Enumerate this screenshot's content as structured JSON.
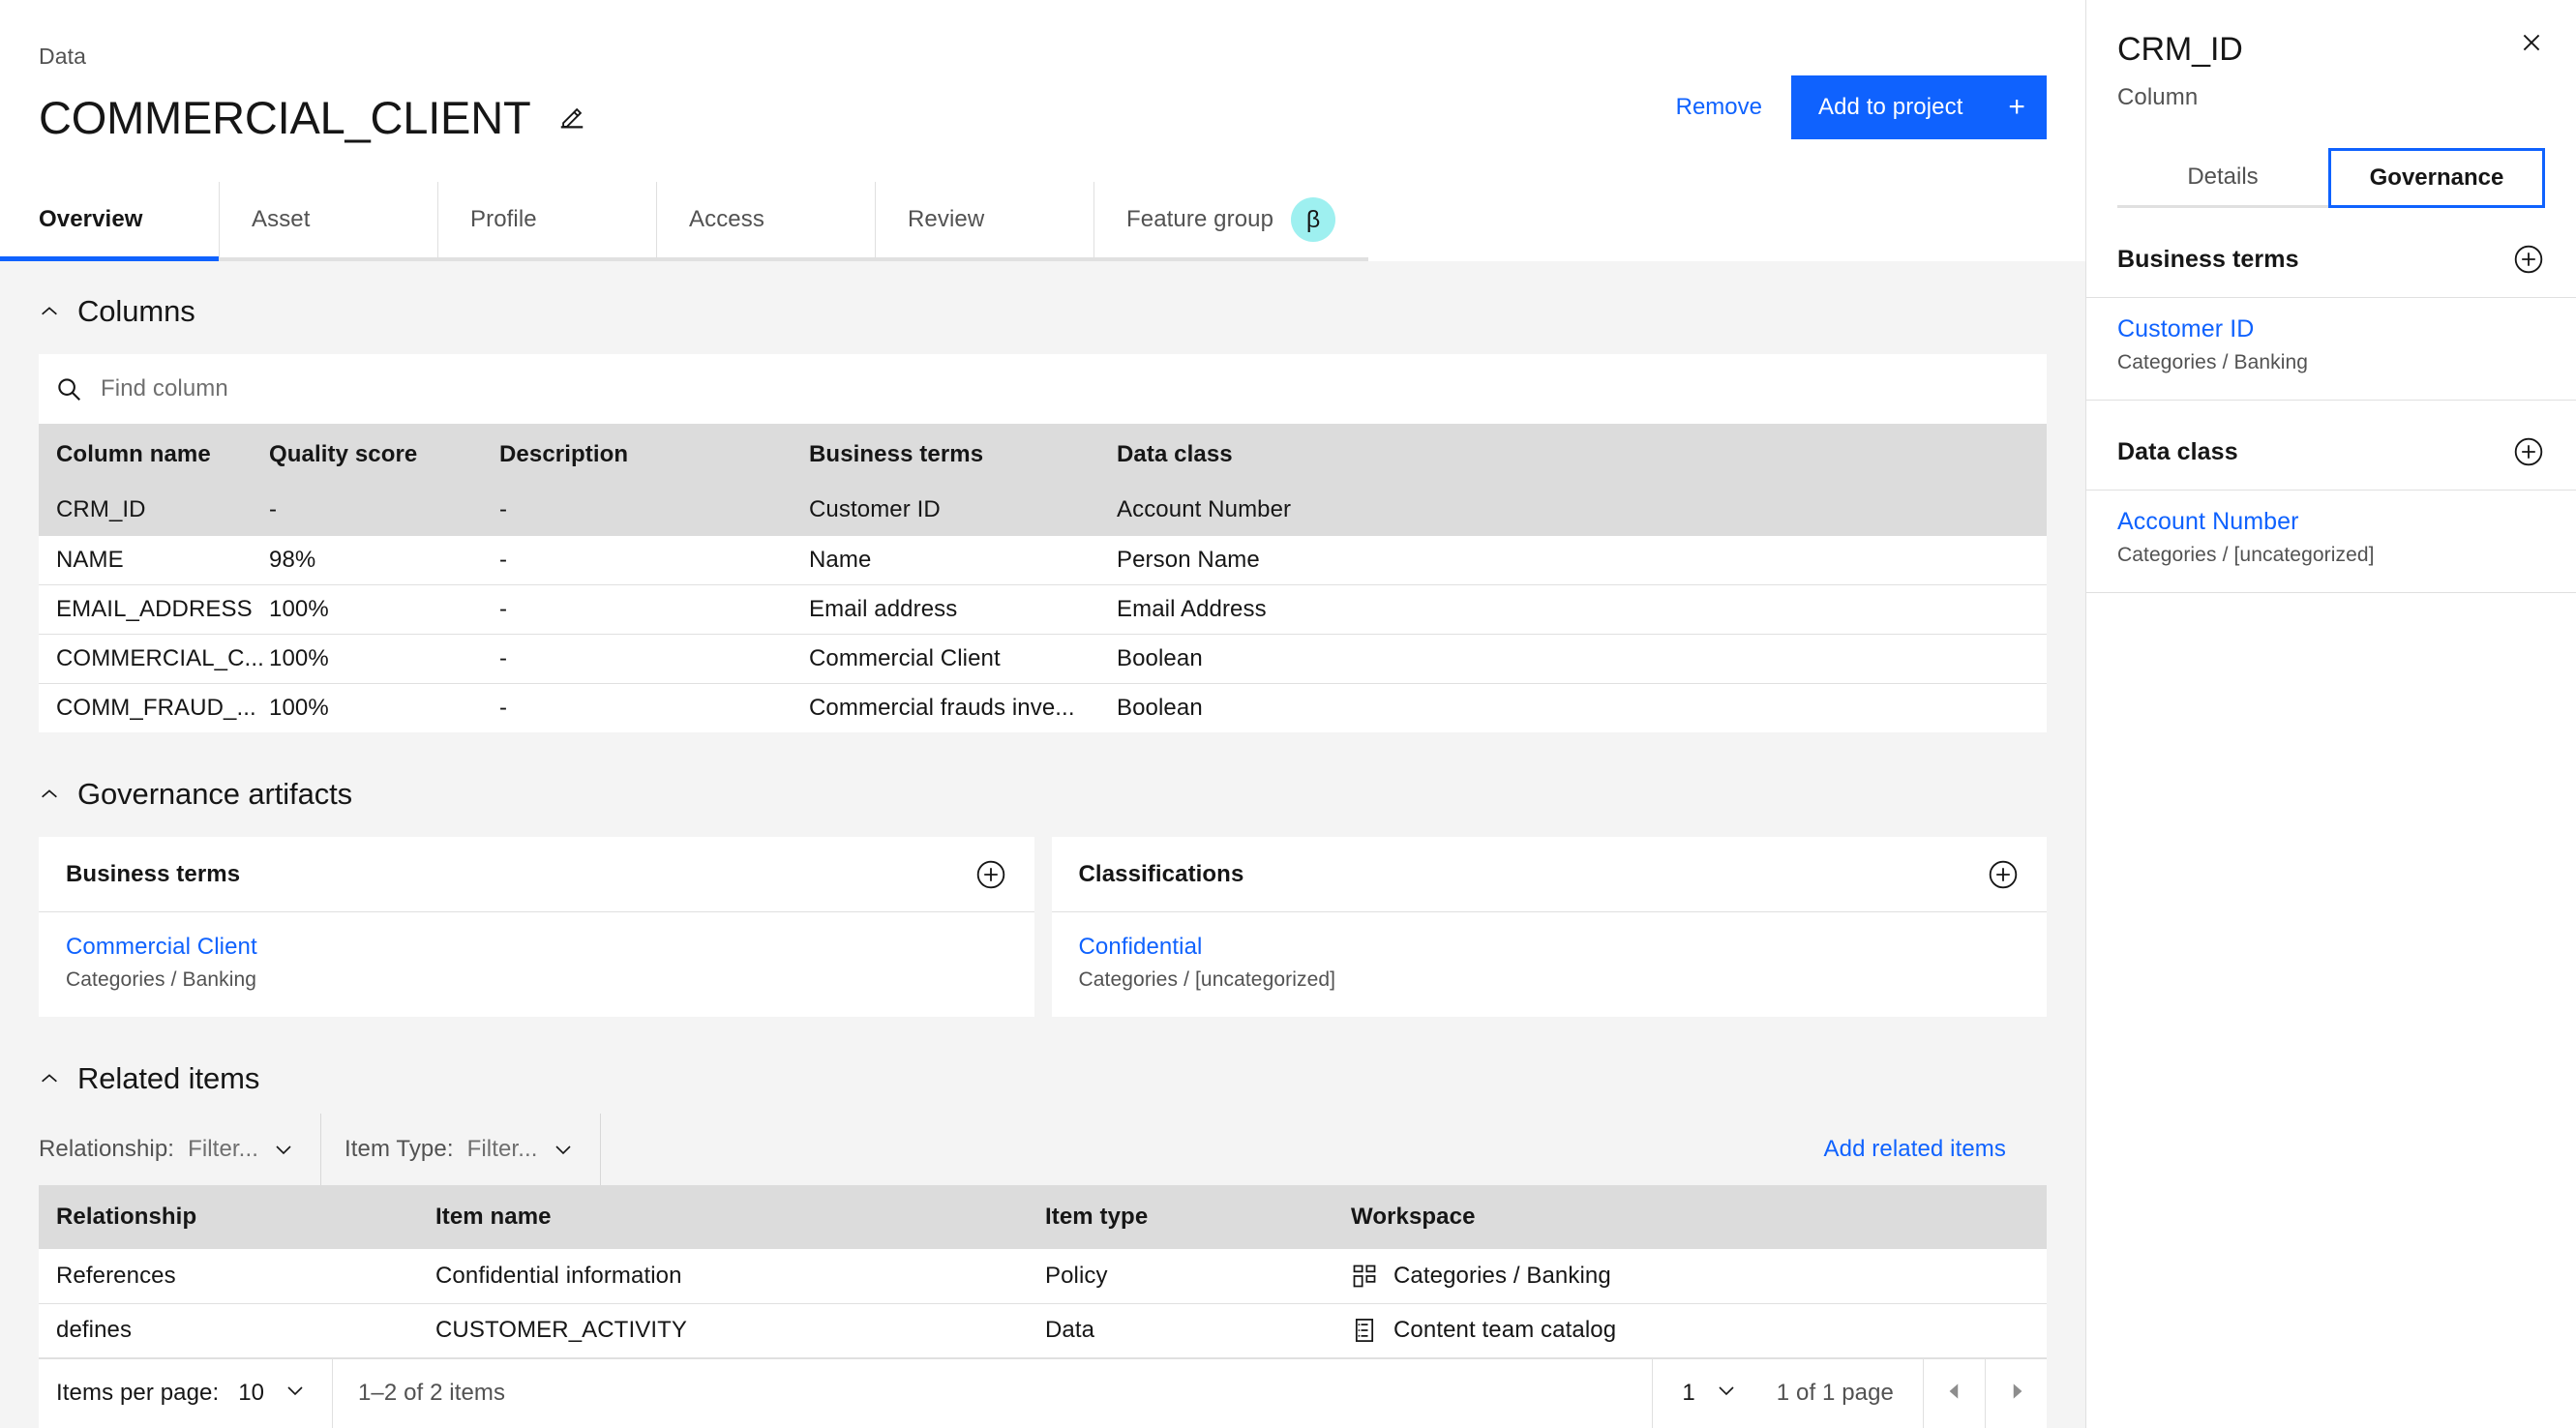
{
  "header": {
    "breadcrumb": "Data",
    "title": "COMMERCIAL_CLIENT",
    "edit_icon": "pencil-edit-icon",
    "remove_label": "Remove",
    "add_to_project_label": "Add to project",
    "add_to_project_plus": "+"
  },
  "tabs": [
    {
      "label": "Overview",
      "active": true
    },
    {
      "label": "Asset",
      "active": false
    },
    {
      "label": "Profile",
      "active": false
    },
    {
      "label": "Access",
      "active": false
    },
    {
      "label": "Review",
      "active": false
    },
    {
      "label": "Feature group",
      "active": false,
      "badge": "β"
    }
  ],
  "columns_section": {
    "title": "Columns",
    "collapse_icon": "chevron-up-icon",
    "search": {
      "placeholder": "Find column",
      "value": "",
      "icon": "search-icon"
    },
    "table": {
      "headers": [
        "Column name",
        "Quality score",
        "Description",
        "Business terms",
        "Data class"
      ],
      "rows": [
        {
          "selected": true,
          "cells": [
            "CRM_ID",
            "-",
            "-",
            "Customer ID",
            "Account Number"
          ]
        },
        {
          "selected": false,
          "cells": [
            "NAME",
            "98%",
            "-",
            "Name",
            "Person Name"
          ]
        },
        {
          "selected": false,
          "cells": [
            "EMAIL_ADDRESS",
            "100%",
            "-",
            "Email address",
            "Email Address"
          ]
        },
        {
          "selected": false,
          "cells": [
            "COMMERCIAL_C...",
            "100%",
            "-",
            "Commercial Client",
            "Boolean"
          ]
        },
        {
          "selected": false,
          "cells": [
            "COMM_FRAUD_...",
            "100%",
            "-",
            "Commercial frauds inve...",
            "Boolean"
          ]
        }
      ]
    }
  },
  "governance_section": {
    "title": "Governance artifacts",
    "collapse_icon": "chevron-up-icon",
    "cards": [
      {
        "heading": "Business terms",
        "add_icon": "add-circle-icon",
        "link": "Commercial Client",
        "category_label": "Categories",
        "separator": "/",
        "category_value": "Banking"
      },
      {
        "heading": "Classifications",
        "add_icon": "add-circle-icon",
        "link": "Confidential",
        "category_label": "Categories",
        "separator": "/",
        "category_value": "[uncategorized]"
      }
    ]
  },
  "related_section": {
    "title": "Related items",
    "collapse_icon": "chevron-up-icon",
    "filters": [
      {
        "label": "Relationship:",
        "value": "Filter...",
        "icon": "chevron-down-icon"
      },
      {
        "label": "Item Type:",
        "value": "Filter...",
        "icon": "chevron-down-icon"
      }
    ],
    "add_related_label": "Add related items",
    "add_related_icon": "chevron-down-icon",
    "table": {
      "headers": [
        "Relationship",
        "Item name",
        "Item type",
        "Workspace"
      ],
      "rows": [
        {
          "relationship": "References",
          "item_name": "Confidential information",
          "item_type": "Policy",
          "workspace": "Categories / Banking",
          "workspace_icon": "categories-grid-icon"
        },
        {
          "relationship": "defines",
          "item_name": "CUSTOMER_ACTIVITY",
          "item_type": "Data",
          "workspace": "Content team catalog",
          "workspace_icon": "catalog-icon"
        }
      ]
    },
    "pagination": {
      "items_per_page_label": "Items per page:",
      "items_per_page_value": "10",
      "items_range": "1–2 of 2 items",
      "page_value": "1",
      "page_of": "1 of 1 page",
      "prev_icon": "caret-left-icon",
      "next_icon": "caret-right-icon",
      "select_icon": "chevron-down-icon"
    }
  },
  "panel": {
    "title": "CRM_ID",
    "subtitle": "Column",
    "close_icon": "close-icon",
    "tabs": [
      {
        "label": "Details",
        "active": false
      },
      {
        "label": "Governance",
        "active": true
      }
    ],
    "sections": [
      {
        "heading": "Business terms",
        "add_icon": "add-circle-icon",
        "link": "Customer ID",
        "category_label": "Categories",
        "separator": "/",
        "category_value": "Banking"
      },
      {
        "heading": "Data class",
        "add_icon": "add-circle-icon",
        "link": "Account Number",
        "category_label": "Categories",
        "separator": "/",
        "category_value": "[uncategorized]"
      }
    ]
  },
  "colors": {
    "accent": "#0f62fe",
    "badge_teal": "#9ef0f0",
    "page_bg": "#f4f4f4",
    "table_header_bg": "#dcdcdc"
  }
}
